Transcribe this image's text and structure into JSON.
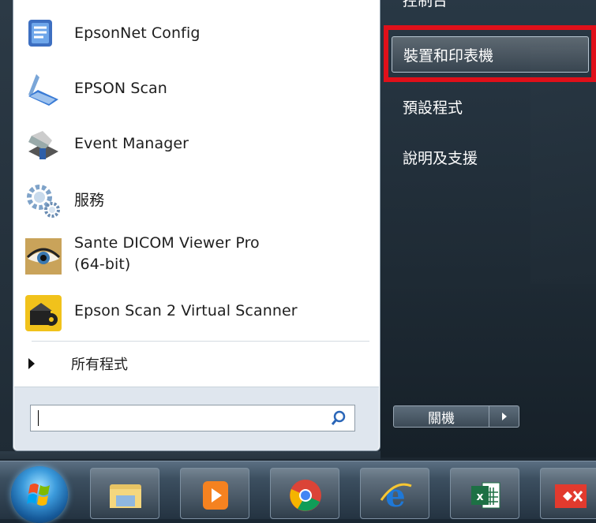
{
  "start_menu": {
    "programs": [
      {
        "label": "EpsonNet Config",
        "icon": "epsonnet-config-icon"
      },
      {
        "label": "EPSON Scan",
        "icon": "epson-scan-icon"
      },
      {
        "label": "Event Manager",
        "icon": "event-manager-icon"
      },
      {
        "label": "服務",
        "icon": "services-gear-icon"
      },
      {
        "label_line1": "Sante DICOM Viewer Pro",
        "label_line2": "(64-bit)",
        "icon": "eye-icon"
      },
      {
        "label": "Epson Scan 2 Virtual Scanner",
        "icon": "virtual-scanner-icon"
      }
    ],
    "all_programs": "所有程式",
    "search": {
      "value": "",
      "icon": "search-icon"
    },
    "right": {
      "cut_item": "控制台",
      "devices_printers": "裝置和印表機",
      "default_programs": "預設程式",
      "help_support": "說明及支援"
    },
    "shutdown_label": "關機",
    "highlight_color": "#e0101a"
  },
  "taskbar": {
    "start_icon": "windows-orb-icon",
    "pinned": [
      "file-explorer-icon",
      "media-player-icon",
      "chrome-icon",
      "internet-explorer-icon",
      "excel-icon",
      "app-icon"
    ]
  }
}
